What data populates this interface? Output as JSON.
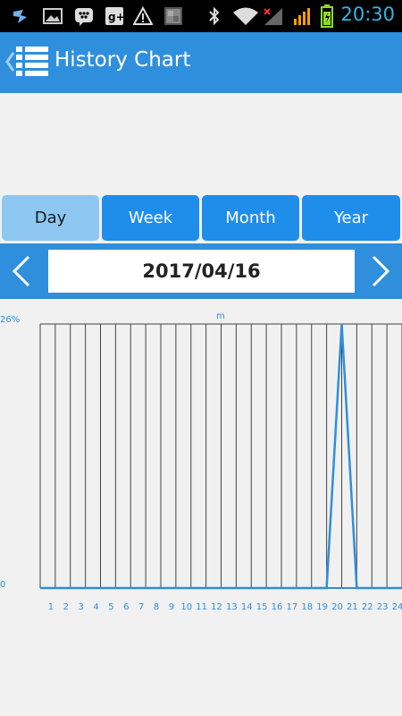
{
  "status_bar": {
    "time": "20:30",
    "icons": [
      "app-notification-icon",
      "gallery-icon",
      "bbm-icon",
      "google-plus-icon",
      "warning-icon",
      "image-icon",
      "bluetooth-icon",
      "wifi-icon",
      "signal-icon",
      "battery-charging-icon"
    ]
  },
  "app_bar": {
    "title": "History Chart",
    "icon": "list-icon"
  },
  "tabs": [
    {
      "label": "Day",
      "active": true
    },
    {
      "label": "Week",
      "active": false
    },
    {
      "label": "Month",
      "active": false
    },
    {
      "label": "Year",
      "active": false
    }
  ],
  "date_nav": {
    "date": "2017/04/16",
    "prev_icon": "chevron-left-icon",
    "next_icon": "chevron-right-icon"
  },
  "colors": {
    "primary": "#2f8fdc",
    "tab": "#1f8eeb",
    "tab_active": "#8ec8f2",
    "series": "#2f8fdc"
  },
  "chart_data": {
    "type": "line",
    "y_top_label": "26%",
    "y_bottom_label": "0",
    "unit_label": "m",
    "ylim": [
      0,
      26
    ],
    "x": [
      "1",
      "2",
      "3",
      "4",
      "5",
      "6",
      "7",
      "8",
      "9",
      "10",
      "11",
      "12",
      "13",
      "14",
      "15",
      "16",
      "17",
      "18",
      "19",
      "20",
      "21",
      "22",
      "23",
      "24"
    ],
    "values": [
      0,
      0,
      0,
      0,
      0,
      0,
      0,
      0,
      0,
      0,
      0,
      0,
      0,
      0,
      0,
      0,
      0,
      0,
      0,
      26,
      0,
      0,
      0,
      0
    ],
    "grid": true
  }
}
